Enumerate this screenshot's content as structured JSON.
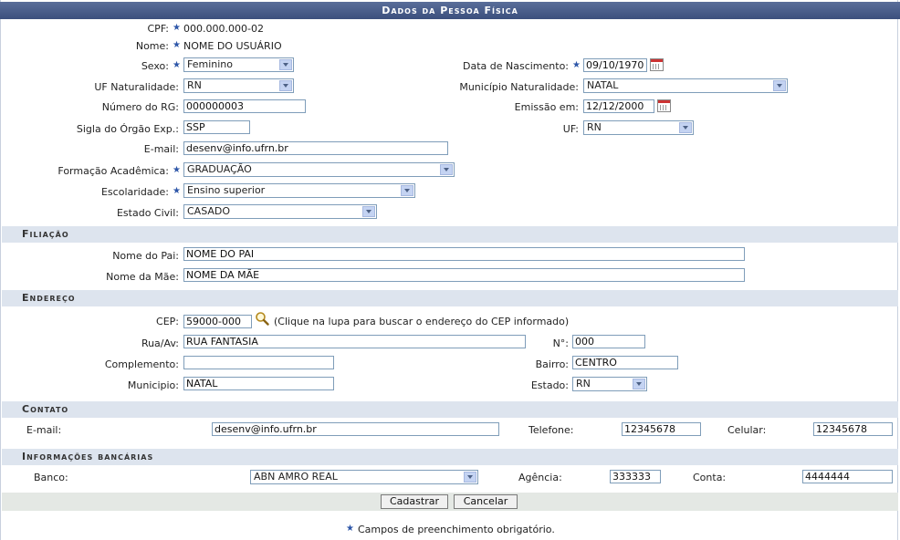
{
  "title": "Dados da Pessoa Física",
  "person": {
    "cpf_label": "CPF:",
    "cpf": "000.000.000-02",
    "nome_label": "Nome:",
    "nome": "NOME DO USUÁRIO",
    "sexo_label": "Sexo:",
    "sexo": "Feminino",
    "nascimento_label": "Data de Nascimento:",
    "nascimento": "09/10/1970",
    "uf_nat_label": "UF Naturalidade:",
    "uf_nat": "RN",
    "mun_nat_label": "Município Naturalidade:",
    "mun_nat": "NATAL",
    "rg_label": "Número do RG:",
    "rg": "000000003",
    "emissao_label": "Emissão em:",
    "emissao": "12/12/2000",
    "orgao_label": "Sigla do Órgão Exp.:",
    "orgao": "SSP",
    "uf_label": "UF:",
    "uf": "RN",
    "email_label": "E-mail:",
    "email": "desenv@info.ufrn.br",
    "formacao_label": "Formação Acadêmica:",
    "formacao": "GRADUAÇÃO",
    "escolaridade_label": "Escolaridade:",
    "escolaridade": "Ensino superior",
    "estado_civil_label": "Estado Civil:",
    "estado_civil": "CASADO"
  },
  "filiacao": {
    "header": "Filiação",
    "pai_label": "Nome do Pai:",
    "pai": "NOME DO PAI",
    "mae_label": "Nome da Mãe:",
    "mae": "NOME DA MÃE"
  },
  "endereco": {
    "header": "Endereço",
    "cep_label": "CEP:",
    "cep": "59000-000",
    "cep_hint": "(Clique na lupa para buscar o endereço do CEP informado)",
    "rua_label": "Rua/Av:",
    "rua": "RUA FANTASIA",
    "numero_label": "N°:",
    "numero": "000",
    "complemento_label": "Complemento:",
    "complemento": "",
    "bairro_label": "Bairro:",
    "bairro": "CENTRO",
    "municipio_label": "Municipio:",
    "municipio": "NATAL",
    "estado_label": "Estado:",
    "estado": "RN"
  },
  "contato": {
    "header": "Contato",
    "email_label": "E-mail:",
    "email": "desenv@info.ufrn.br",
    "telefone_label": "Telefone:",
    "telefone": "12345678",
    "celular_label": "Celular:",
    "celular": "12345678"
  },
  "bancario": {
    "header": "Informações bancárias",
    "banco_label": "Banco:",
    "banco": "ABN AMRO REAL",
    "agencia_label": "Agência:",
    "agencia": "333333",
    "conta_label": "Conta:",
    "conta": "4444444"
  },
  "actions": {
    "cadastrar": "Cadastrar",
    "cancelar": "Cancelar"
  },
  "footer_note": "Campos de preenchimento obrigatório."
}
